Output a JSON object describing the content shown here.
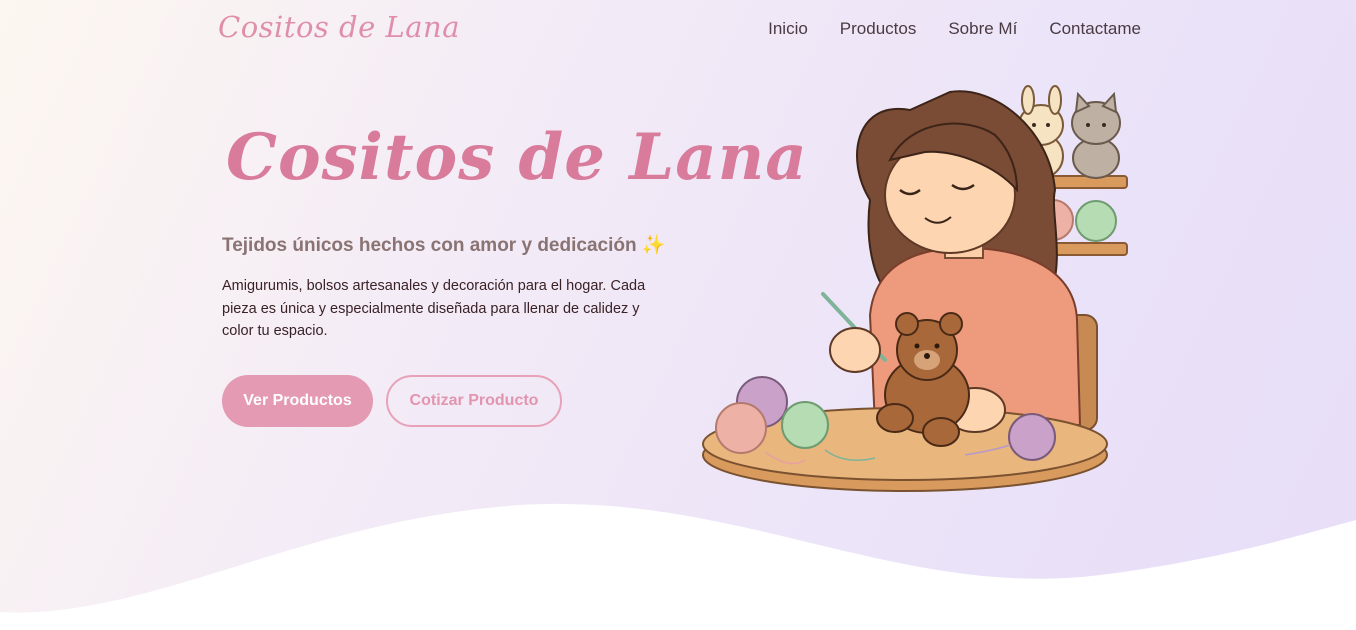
{
  "brand": {
    "name": "Cositos de Lana"
  },
  "nav": {
    "items": [
      {
        "label": "Inicio"
      },
      {
        "label": "Productos"
      },
      {
        "label": "Sobre Mí"
      },
      {
        "label": "Contactame"
      }
    ]
  },
  "hero": {
    "title": "Cositos de Lana",
    "subtitle": "Tejidos únicos hechos con amor y dedicación ✨",
    "description": "Amigurumis, bolsos artesanales y decoración para el hogar. Cada pieza es única y especialmente diseñada para llenar de calidez y color tu espacio.",
    "primary_button": "Ver Productos",
    "secondary_button": "Cotizar Producto"
  },
  "colors": {
    "accent": "#e49ab2",
    "title": "#d97b9a",
    "background": "#ebe3f8"
  },
  "illustration": {
    "name": "woman-crocheting-teddy-illustration"
  }
}
